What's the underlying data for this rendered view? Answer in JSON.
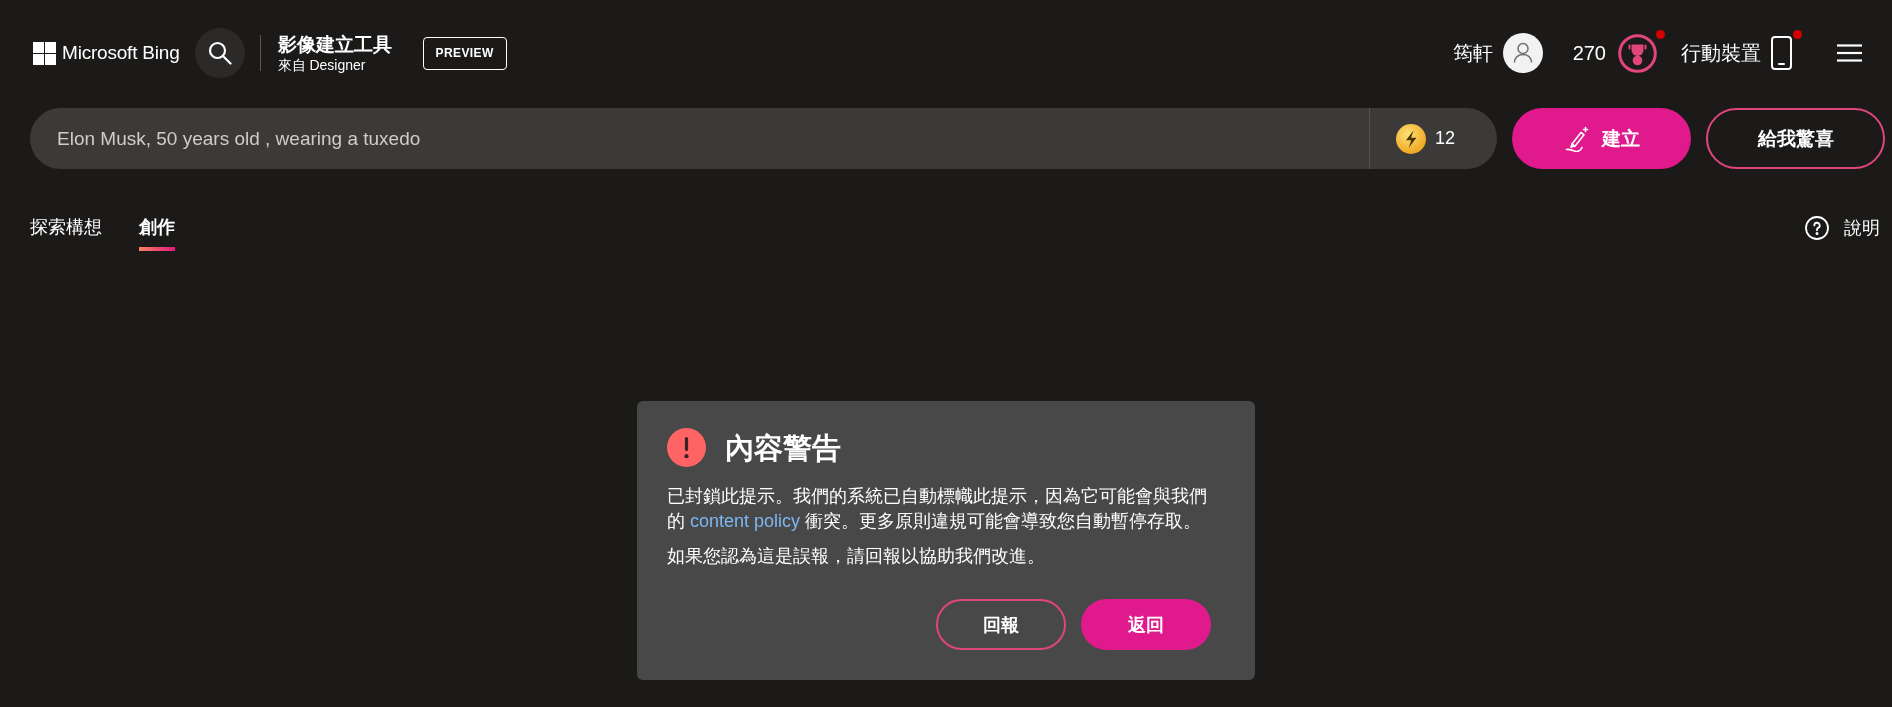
{
  "header": {
    "brand": "Microsoft Bing",
    "app_title": "影像建立工具",
    "app_subtitle": "來自 Designer",
    "badge": "PREVIEW",
    "user_name": "筠軒",
    "points": "270",
    "points_notification": true,
    "mobile_label": "行動裝置",
    "mobile_notification": true
  },
  "prompt": {
    "value": "Elon Musk, 50 years old , wearing a tuxedo",
    "boosts": "12"
  },
  "actions": [
    {
      "label": "建立",
      "kind": "primary"
    },
    {
      "label": "給我驚喜",
      "kind": "outline"
    }
  ],
  "tabs": [
    {
      "label": "探索構想",
      "selected": false
    },
    {
      "label": "創作",
      "selected": true
    }
  ],
  "help": {
    "label": "說明"
  },
  "dialog": {
    "title": "內容警告",
    "message": {
      "before": "已封鎖此提示。我們的系統已自動標幟此提示，因為它可能會與我們的 ",
      "link": "content policy",
      "after": " 衝突。更多原則違規可能會導致您自動暫停存取。"
    },
    "note": "如果您認為這是誤報，請回報以協助我們改進。",
    "buttons": [
      {
        "label": "回報",
        "kind": "outline"
      },
      {
        "label": "返回",
        "kind": "primary"
      }
    ]
  }
}
